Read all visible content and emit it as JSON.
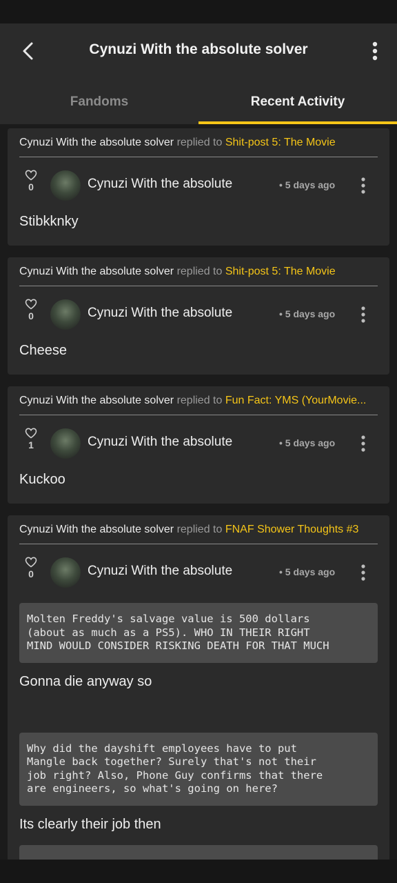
{
  "header": {
    "title": "Cynuzi With the absolute solver",
    "back_icon": "chevron-left-icon",
    "more_icon": "kebab-menu-icon"
  },
  "tabs": [
    {
      "label": "Fandoms",
      "active": false
    },
    {
      "label": "Recent Activity",
      "active": true
    }
  ],
  "colors": {
    "accent": "#f5c518",
    "card": "#2b2b2b",
    "quote": "#4b4b4b"
  },
  "posts": [
    {
      "who": "Cynuzi With the absolute solver",
      "verb": "replied to",
      "target": "Shit-post 5: The Movie",
      "likes": "0",
      "author": "Cynuzi With the absolute",
      "time": "• 5 days ago",
      "text": "Stibkknky"
    },
    {
      "who": "Cynuzi With the absolute solver",
      "verb": "replied to",
      "target": "Shit-post 5: The Movie",
      "likes": "0",
      "author": "Cynuzi With the absolute",
      "time": "• 5 days ago",
      "text": "Cheese"
    },
    {
      "who": "Cynuzi With the absolute solver",
      "verb": "replied to",
      "target": "Fun Fact: YMS (YourMovie...",
      "likes": "1",
      "author": "Cynuzi With the absolute",
      "time": "• 5 days ago",
      "text": "Kuckoo"
    },
    {
      "who": "Cynuzi With the absolute solver",
      "verb": "replied to",
      "target": "FNAF Shower Thoughts #3",
      "likes": "0",
      "author": "Cynuzi With the absolute",
      "time": "• 5 days ago",
      "quote1": "Molten Freddy's salvage value is 500 dollars\n(about as much as a PS5). WHO IN THEIR RIGHT\nMIND WOULD CONSIDER RISKING DEATH FOR THAT MUCH",
      "reply1": "Gonna die anyway so",
      "quote2": "Why did the dayshift employees have to put\nMangle back together? Surely that's not their\njob right? Also, Phone Guy confirms that there\nare engineers, so what's going on here?",
      "reply2": "Its clearly their job then"
    }
  ]
}
